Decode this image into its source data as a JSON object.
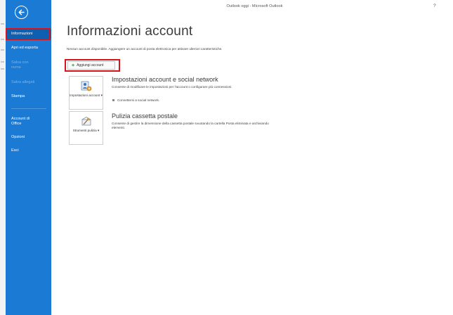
{
  "window": {
    "title": "Outlook oggi - Microsoft Outlook",
    "help": "?"
  },
  "sidebar": {
    "items": [
      {
        "label": "Informazioni"
      },
      {
        "label": "Apri ed esporta"
      },
      {
        "label": "Salva con nome"
      },
      {
        "label": "Salva allegati"
      },
      {
        "label": "Stampa"
      },
      {
        "label": "Account di Office"
      },
      {
        "label": "Opzioni"
      },
      {
        "label": "Esci"
      }
    ]
  },
  "main": {
    "title": "Informazioni account",
    "intro": "Nessun account disponibile. Aggiungere un account di posta elettronica per attivare ulteriori caratteristiche.",
    "add_account_label": "Aggiungi account",
    "sections": [
      {
        "tile_label": "Impostazioni account",
        "tile_arrow": "▾",
        "title": "Impostazioni account e social network",
        "description": "Consente di modificare le impostazioni per l'account o configurare più connessioni.",
        "link": "Connettersi a social network."
      },
      {
        "tile_label": "Strumenti pulizia",
        "tile_arrow": "▾",
        "title": "Pulizia cassetta postale",
        "description": "Consente di gestire la dimensione della cassetta postale svuotando la cartella Posta eliminata e archiviando elementi."
      }
    ]
  },
  "colors": {
    "sidebar": "#1a7ad4",
    "sidebar_selected": "#0f5fb0",
    "highlight": "#d6141c"
  },
  "icons": {
    "back": "back-arrow-circle-icon",
    "add": "plus-icon",
    "account_settings": "account-settings-icon",
    "cleanup": "cleanup-tools-icon"
  }
}
